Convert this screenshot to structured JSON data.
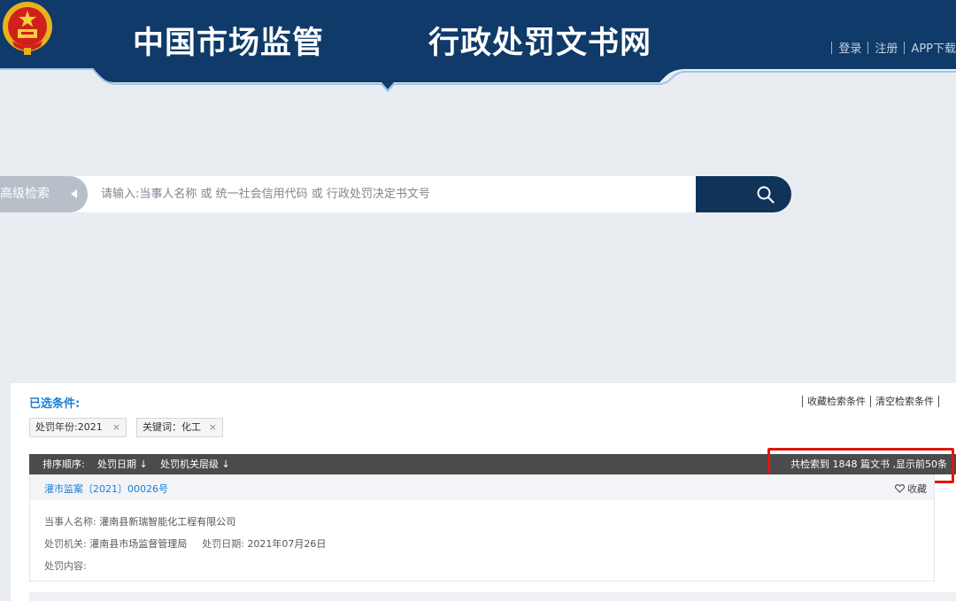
{
  "header": {
    "title_left": "中国市场监管",
    "title_right": "行政处罚文书网",
    "links": [
      "登录",
      "注册",
      "APP下载"
    ]
  },
  "search": {
    "advanced_label": "高级检索",
    "placeholder": "请输入:当事人名称 或 统一社会信用代码 或 行政处罚决定书文号"
  },
  "conditions": {
    "title": "已选条件:",
    "save_label": "收藏检索条件",
    "clear_label": "清空检索条件",
    "tags": [
      {
        "label": "处罚年份:2021",
        "remove": "×"
      },
      {
        "label": "关键词：化工",
        "remove": "×"
      }
    ]
  },
  "sort": {
    "label": "排序顺序:",
    "by_date": "处罚日期 ↓",
    "by_level": "处罚机关层级 ↓",
    "result_count_text": "共检索到 1848 篇文书 ,显示前50条"
  },
  "results": [
    {
      "doc_number": "灌市监案〔2021〕00026号",
      "favorite_label": "收藏",
      "party_label": "当事人名称:",
      "party_value": "灌南县新瑞智能化工程有限公司",
      "agency_label": "处罚机关:",
      "agency_value": "灌南县市场监督管理局",
      "date_label": "处罚日期:",
      "date_value": "2021年07月26日",
      "content_label": "处罚内容:"
    }
  ],
  "colors": {
    "header_navy": "#0f3a69",
    "banner_blue": "#2f97e3",
    "link_blue": "#1a7fd4",
    "search_button": "#10335a",
    "highlight_red": "#e3150e",
    "sortbar": "#4b4b4b"
  }
}
